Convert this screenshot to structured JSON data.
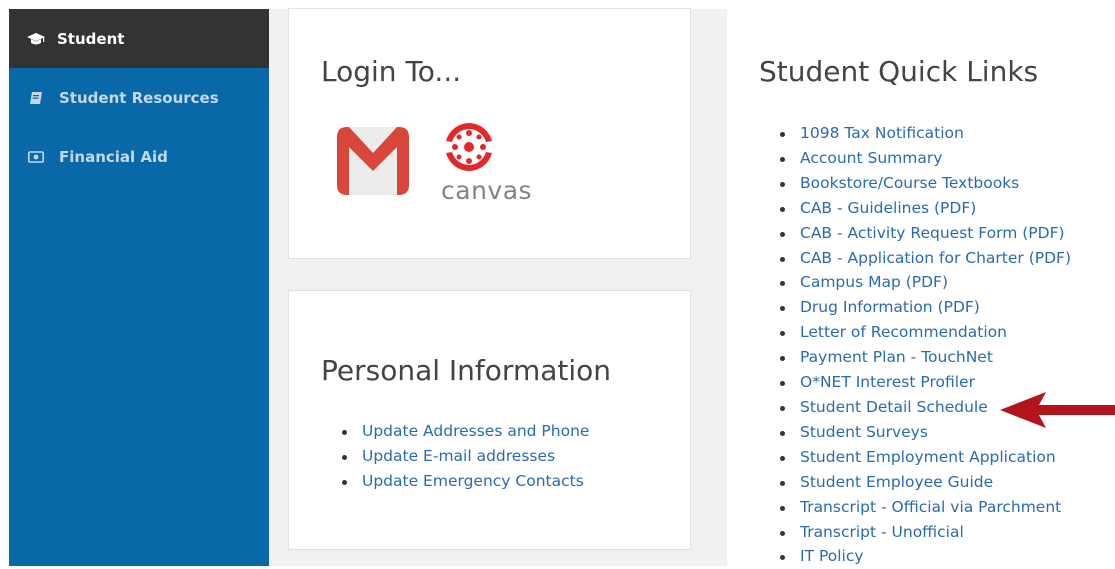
{
  "sidebar": {
    "items": [
      {
        "label": "Student",
        "icon": "graduation-cap-icon",
        "active": true
      },
      {
        "label": "Student Resources",
        "icon": "book-icon",
        "active": false
      },
      {
        "label": "Financial Aid",
        "icon": "money-icon",
        "active": false
      }
    ]
  },
  "login": {
    "title": "Login To...",
    "canvas_text": "canvas"
  },
  "personal": {
    "title": "Personal Information",
    "links": [
      "Update Addresses and Phone",
      "Update E-mail addresses",
      "Update Emergency Contacts"
    ]
  },
  "quick_links": {
    "title": "Student Quick Links",
    "links": [
      "1098 Tax Notification",
      "Account Summary",
      "Bookstore/Course Textbooks",
      "CAB - Guidelines (PDF)",
      "CAB - Activity Request Form (PDF)",
      "CAB - Application for Charter (PDF)",
      "Campus Map (PDF)",
      "Drug Information (PDF)",
      "Letter of Recommendation",
      "Payment Plan - TouchNet",
      "O*NET Interest Profiler",
      "Student Detail Schedule",
      "Student Surveys",
      "Student Employment Application",
      "Student Employee Guide",
      "Transcript - Official via Parchment",
      "Transcript - Unofficial",
      "IT Policy"
    ]
  },
  "colors": {
    "sidebar_bg": "#0868a8",
    "sidebar_active_bg": "#333333",
    "link": "#2a6bb0",
    "arrow": "#b3131b",
    "gmail_red": "#d9463b",
    "canvas_red": "#e1292b"
  }
}
